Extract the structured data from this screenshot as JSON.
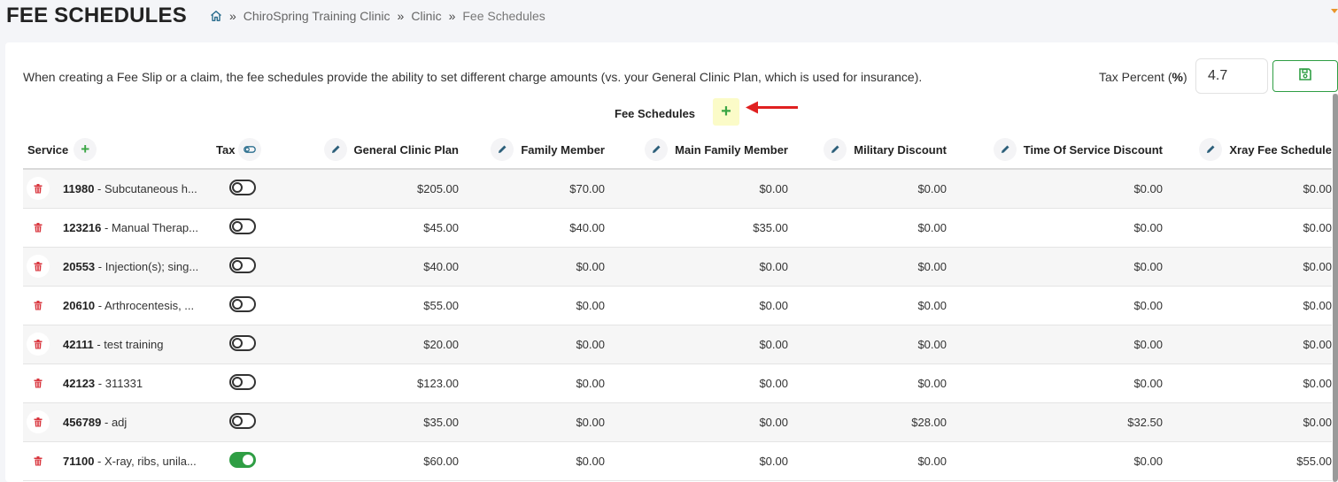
{
  "header": {
    "title": "FEE SCHEDULES",
    "breadcrumb": [
      "ChiroSpring Training Clinic",
      "Clinic",
      "Fee Schedules"
    ],
    "separator": "»"
  },
  "intro_text": "When creating a Fee Slip or a claim, the fee schedules provide the ability to set different charge amounts (vs. your General Clinic Plan, which is used for insurance).",
  "tax": {
    "label": "Tax Percent (",
    "symbol": "%",
    "label_end": ")",
    "value": "4.7"
  },
  "fee_schedules_title": "Fee Schedules",
  "fee_schedules_add": "+",
  "table": {
    "service_header": "Service",
    "tax_header": "Tax",
    "schedules": [
      "General Clinic Plan",
      "Family Member",
      "Main Family Member",
      "Military Discount",
      "Time Of Service Discount",
      "Xray Fee Schedule"
    ],
    "rows": [
      {
        "code": "11980",
        "desc": " - Subcutaneous h...",
        "tax_on": false,
        "fees": [
          "$205.00",
          "$70.00",
          "$0.00",
          "$0.00",
          "$0.00",
          "$0.00"
        ]
      },
      {
        "code": "123216",
        "desc": " - Manual Therap...",
        "tax_on": false,
        "fees": [
          "$45.00",
          "$40.00",
          "$35.00",
          "$0.00",
          "$0.00",
          "$0.00"
        ]
      },
      {
        "code": "20553",
        "desc": " - Injection(s); sing...",
        "tax_on": false,
        "fees": [
          "$40.00",
          "$0.00",
          "$0.00",
          "$0.00",
          "$0.00",
          "$0.00"
        ]
      },
      {
        "code": "20610",
        "desc": " - Arthrocentesis, ...",
        "tax_on": false,
        "fees": [
          "$55.00",
          "$0.00",
          "$0.00",
          "$0.00",
          "$0.00",
          "$0.00"
        ]
      },
      {
        "code": "42111",
        "desc": " - test training",
        "tax_on": false,
        "fees": [
          "$20.00",
          "$0.00",
          "$0.00",
          "$0.00",
          "$0.00",
          "$0.00"
        ]
      },
      {
        "code": "42123",
        "desc": " - 311331",
        "tax_on": false,
        "fees": [
          "$123.00",
          "$0.00",
          "$0.00",
          "$0.00",
          "$0.00",
          "$0.00"
        ]
      },
      {
        "code": "456789",
        "desc": " - adj",
        "tax_on": false,
        "fees": [
          "$35.00",
          "$0.00",
          "$0.00",
          "$28.00",
          "$32.50",
          "$0.00"
        ]
      },
      {
        "code": "71100",
        "desc": " - X-ray, ribs, unila...",
        "tax_on": true,
        "fees": [
          "$60.00",
          "$0.00",
          "$0.00",
          "$0.00",
          "$0.00",
          "$55.00"
        ]
      }
    ]
  },
  "colors": {
    "accent_green": "#2f9e44",
    "trash_red": "#d9363e",
    "arrow_red": "#e02020",
    "highlight": "#fbfbc8"
  },
  "icons": {
    "home": "home-icon",
    "save": "save-icon",
    "edit": "pencil-icon",
    "delete": "trash-icon",
    "tax_toggle": "link-icon",
    "add": "plus-icon"
  }
}
